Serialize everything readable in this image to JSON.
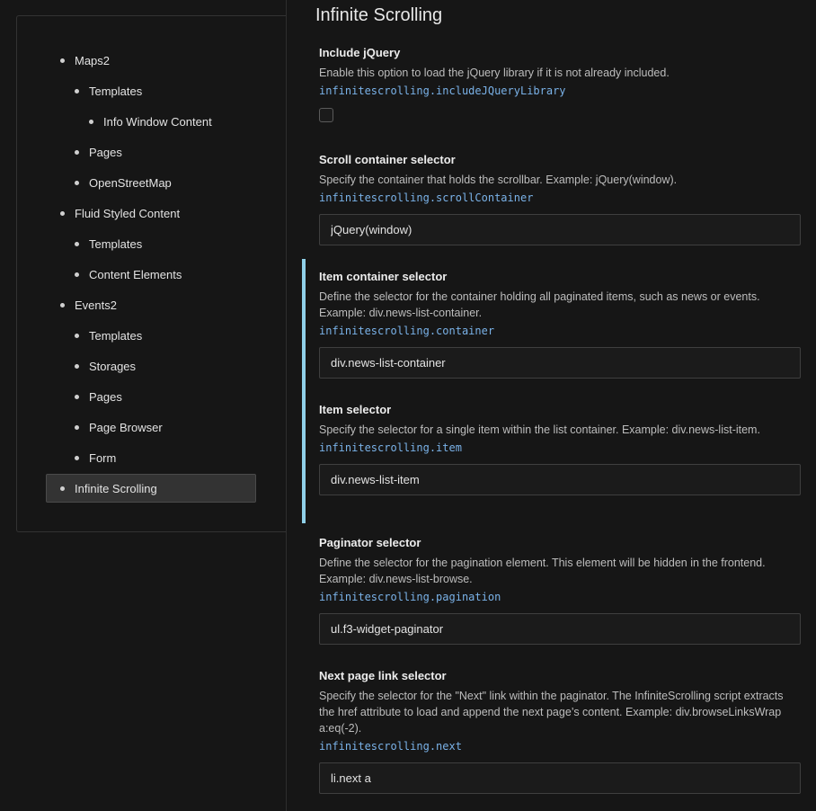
{
  "tree": {
    "items": [
      {
        "label": "Maps2",
        "level": 1
      },
      {
        "label": "Templates",
        "level": 2
      },
      {
        "label": "Info Window Content",
        "level": 3
      },
      {
        "label": "Pages",
        "level": 2
      },
      {
        "label": "OpenStreetMap",
        "level": 2
      },
      {
        "label": "Fluid Styled Content",
        "level": 1
      },
      {
        "label": "Templates",
        "level": 2
      },
      {
        "label": "Content Elements",
        "level": 2
      },
      {
        "label": "Events2",
        "level": 1
      },
      {
        "label": "Templates",
        "level": 2
      },
      {
        "label": "Storages",
        "level": 2
      },
      {
        "label": "Pages",
        "level": 2
      },
      {
        "label": "Page Browser",
        "level": 2
      },
      {
        "label": "Form",
        "level": 2
      },
      {
        "label": "Infinite Scrolling",
        "level": 1,
        "active": true
      }
    ]
  },
  "page": {
    "title": "Infinite Scrolling"
  },
  "settings": [
    {
      "label": "Include jQuery",
      "description": "Enable this option to load the jQuery library if it is not already included.",
      "key": "infinitescrolling.includeJQueryLibrary",
      "type": "checkbox",
      "checked": false
    },
    {
      "label": "Scroll container selector",
      "description": "Specify the container that holds the scrollbar. Example: jQuery(window).",
      "key": "infinitescrolling.scrollContainer",
      "type": "text",
      "value": "jQuery(window)"
    },
    {
      "label": "Item container selector",
      "description": "Define the selector for the container holding all paginated items, such as news or events. Example: div.news-list-container.",
      "key": "infinitescrolling.container",
      "type": "text",
      "value": "div.news-list-container",
      "modified": true
    },
    {
      "label": "Item selector",
      "description": "Specify the selector for a single item within the list container. Example: div.news-list-item.",
      "key": "infinitescrolling.item",
      "type": "text",
      "value": "div.news-list-item",
      "modified": true
    },
    {
      "label": "Paginator selector",
      "description": "Define the selector for the pagination element. This element will be hidden in the frontend. Example: div.news-list-browse.",
      "key": "infinitescrolling.pagination",
      "type": "text",
      "value": "ul.f3-widget-paginator"
    },
    {
      "label": "Next page link selector",
      "description": "Specify the selector for the \"Next\" link within the paginator. The InfiniteScrolling script extracts the href attribute to load and append the next page’s content. Example: div.browseLinksWrap a:eq(-2).",
      "key": "infinitescrolling.next",
      "type": "text",
      "value": "li.next a"
    }
  ]
}
